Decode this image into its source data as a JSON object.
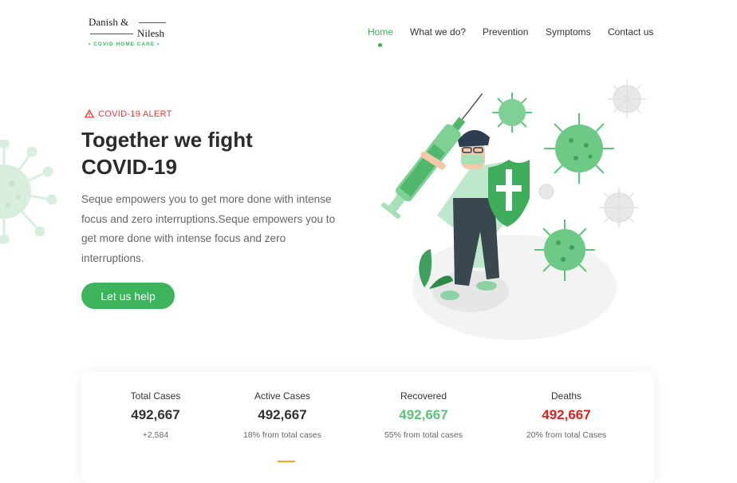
{
  "brand": {
    "line1": "Danish &",
    "line2": "Nilesh",
    "tagline": "•  COVID HOME CARE  •"
  },
  "nav": {
    "items": [
      {
        "label": "Home",
        "active": true
      },
      {
        "label": "What we do?"
      },
      {
        "label": "Prevention"
      },
      {
        "label": "Symptoms"
      },
      {
        "label": "Contact us"
      }
    ]
  },
  "hero": {
    "alert": "COVID-19 ALERT",
    "title_line1": "Together we fight",
    "title_line2": "COVID-19",
    "description": "Seque empowers you to get more done with intense focus and zero interruptions.Seque empowers you to get more done with intense focus and zero interruptions.",
    "cta": "Let us help"
  },
  "stats": [
    {
      "label": "Total Cases",
      "value": "492,667",
      "sub": "+2,584"
    },
    {
      "label": "Active Cases",
      "value": "492,667",
      "sub": "18% from total cases"
    },
    {
      "label": "Recovered",
      "value": "492,667",
      "sub": "55% from total cases"
    },
    {
      "label": "Deaths",
      "value": "492,667",
      "sub": "20% from total Cases"
    }
  ],
  "colors": {
    "accent": "#3db35d",
    "alert": "#e53935",
    "recovered": "#5dc27a",
    "deaths": "#e02020"
  }
}
